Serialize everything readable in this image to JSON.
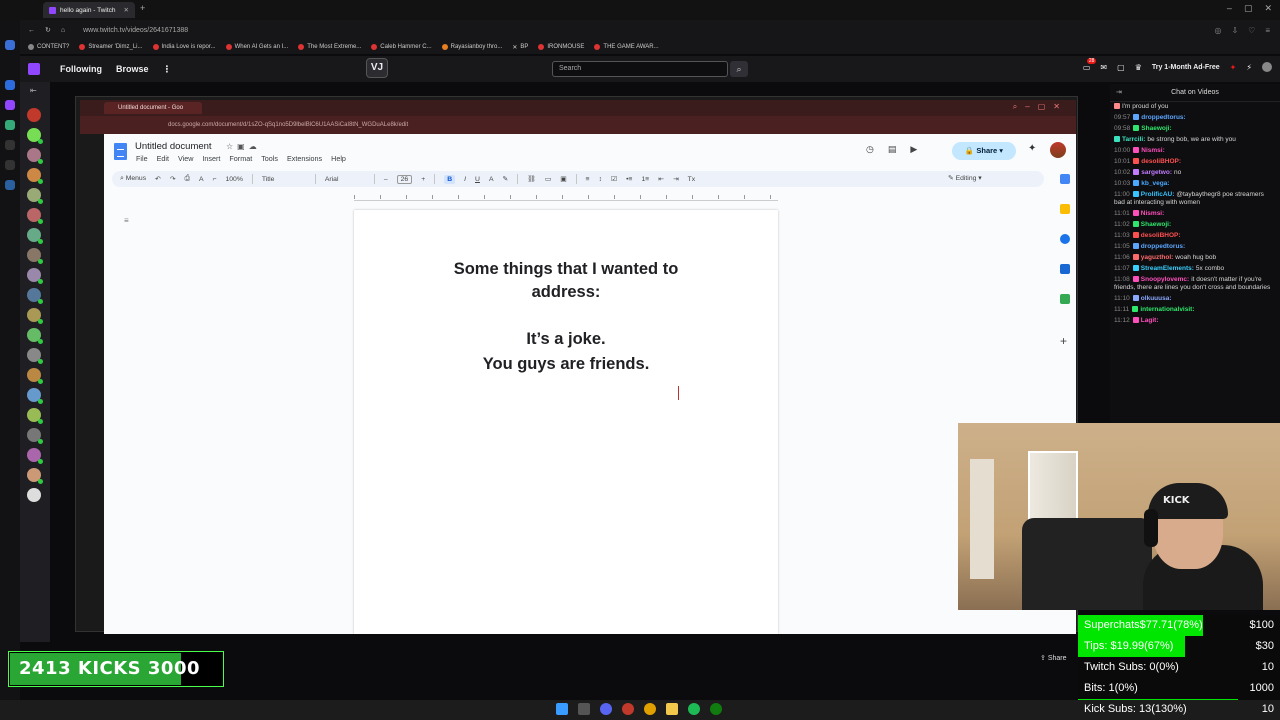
{
  "browser": {
    "tab_title": "hello again - Twitch",
    "url": "www.twitch.tv/videos/2641671388",
    "bookmarks": [
      "CONTENT?",
      "Streamer 'Dimz_Li...",
      "India Love is repor...",
      "When AI Gets an I...",
      "The Most Extreme...",
      "Caleb Hammer C...",
      "Rayasianboy thro...",
      "BP",
      "IRONMOUSE",
      "THE GAME AWAR..."
    ]
  },
  "twitch": {
    "nav_following": "Following",
    "nav_browse": "Browse",
    "nav_more": "⋮",
    "search_placeholder": "Search",
    "ad_free": "Try 1-Month Ad-Free",
    "notif_count": "28",
    "chat_title": "Chat on Videos",
    "share": "Share"
  },
  "inner_browser": {
    "tab_title": "Untitled document - Goo",
    "url": "docs.google.com/document/d/1sZO-qSq1no5D9lbelBlC6U1AASiCaI8tN_WGDuALe8k/edit"
  },
  "docs": {
    "title": "Untitled document",
    "menu": [
      "File",
      "Edit",
      "View",
      "Insert",
      "Format",
      "Tools",
      "Extensions",
      "Help"
    ],
    "share_label": "Share",
    "toolbar": {
      "menus": "Menus",
      "zoom": "100%",
      "style": "Title",
      "font": "Arial",
      "size": "26",
      "bold": "B",
      "italic": "I",
      "underline": "U",
      "mode": "Editing"
    },
    "lines": [
      "Some things that I wanted to",
      "address:",
      "It’s a joke.",
      "You guys are friends."
    ]
  },
  "chat": [
    {
      "time": "",
      "user": "",
      "color": "#ff8a8a",
      "text": "I'm proud of you"
    },
    {
      "time": "09:57",
      "user": "droppedtorus:",
      "color": "#5ca6ff",
      "text": ""
    },
    {
      "time": "09:58",
      "user": "Shaewoji:",
      "color": "#2ee66b",
      "text": ""
    },
    {
      "time": "",
      "user": "Tarrcili:",
      "color": "#3ae2c0",
      "text": "be strong bob, we are with you"
    },
    {
      "time": "10:00",
      "user": "Nismsi:",
      "color": "#ff4fbd",
      "text": ""
    },
    {
      "time": "10:01",
      "user": "desoliBHOP:",
      "color": "#ff5050",
      "text": ""
    },
    {
      "time": "10:02",
      "user": "sargetwo:",
      "color": "#c27bff",
      "text": "no"
    },
    {
      "time": "10:03",
      "user": "kb_vega:",
      "color": "#4aa8ff",
      "text": ""
    },
    {
      "time": "11:00",
      "user": "ProlificAU:",
      "color": "#36c5ff",
      "text": "@taybaythegr8 poe streamers bad at interacting with women"
    },
    {
      "time": "11:01",
      "user": "Nismsi:",
      "color": "#ff4fbd",
      "text": ""
    },
    {
      "time": "11:02",
      "user": "Shaewoji:",
      "color": "#2ee66b",
      "text": ""
    },
    {
      "time": "11:03",
      "user": "desoliBHOP:",
      "color": "#ff5050",
      "text": ""
    },
    {
      "time": "11:05",
      "user": "droppedtorus:",
      "color": "#5ca6ff",
      "text": ""
    },
    {
      "time": "11:06",
      "user": "yaguzthol:",
      "color": "#ff6b6b",
      "text": "woah hug bob"
    },
    {
      "time": "11:07",
      "user": "StreamElements:",
      "color": "#39d0ff",
      "text": "5x combo"
    },
    {
      "time": "11:08",
      "user": "Snoopylovemc:",
      "color": "#ff4fbd",
      "text": "it doesn't matter if you're friends, there are lines you don't cross and boundaries"
    },
    {
      "time": "11:10",
      "user": "olkuuusa:",
      "color": "#8aa8ff",
      "text": ""
    },
    {
      "time": "11:11",
      "user": "internationalvisit:",
      "color": "#2ee66b",
      "text": ""
    },
    {
      "time": "11:12",
      "user": "Lagit:",
      "color": "#ff4fbd",
      "text": ""
    }
  ],
  "webcam": {
    "cap_text": "KICK"
  },
  "goals": {
    "kicks_label": "2413   KICKS   3000",
    "kicks_progress": 0.8,
    "rows": [
      {
        "label": "Superchats$77.71(78%)",
        "value": "$100",
        "progress": 0.78
      },
      {
        "label": "Tips:       $19.99(67%)",
        "value": "$30",
        "progress": 0.67
      },
      {
        "label": "Twitch Subs:   0(0%)",
        "value": "10",
        "progress": 0
      },
      {
        "label": "Bits:           1(0%)",
        "value": "1000",
        "progress": 0
      },
      {
        "label": "Kick Subs:   13(130%)",
        "value": "10",
        "progress": 1.0
      }
    ]
  },
  "colors": {
    "twitch_purple": "#9146ff",
    "docs_blue": "#4285f4",
    "goal_green": "#00e600"
  }
}
